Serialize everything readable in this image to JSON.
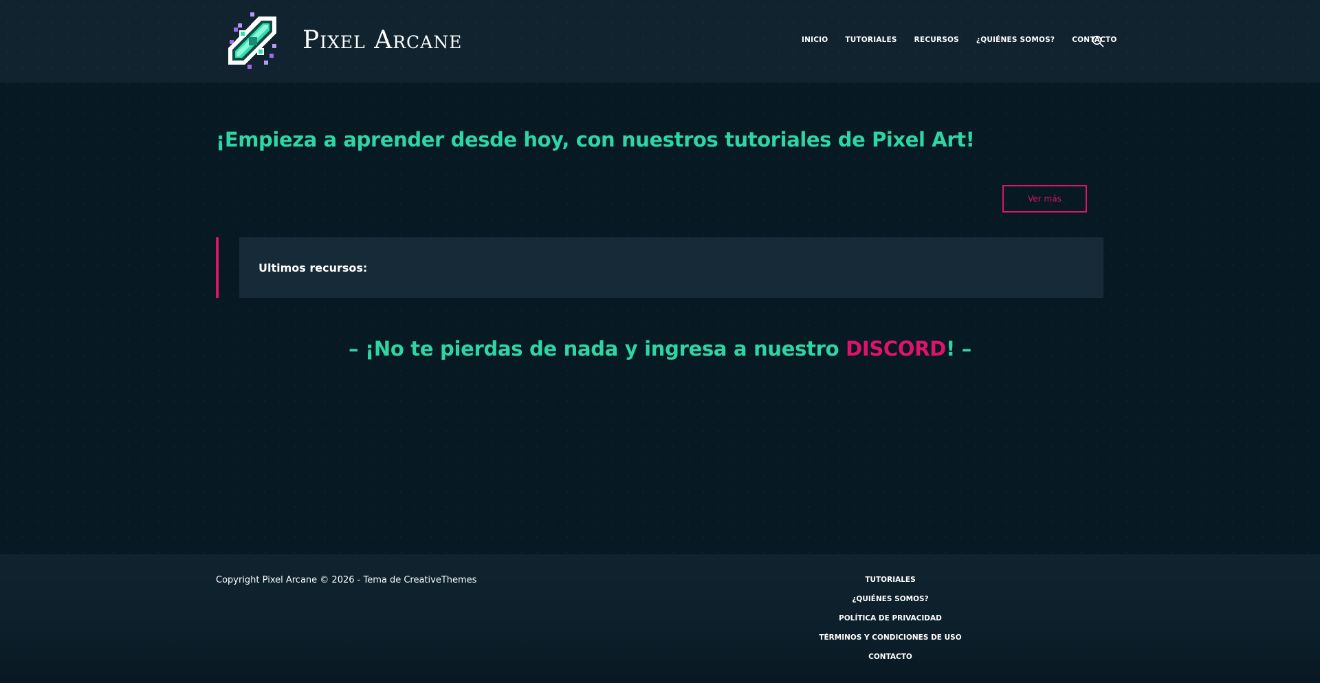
{
  "site": {
    "title": "Pixel Arcane"
  },
  "nav": {
    "items": [
      {
        "label": "INICIO"
      },
      {
        "label": "TUTORIALES"
      },
      {
        "label": "RECURSOS"
      },
      {
        "label": "¿QUIÉNES SOMOS?"
      },
      {
        "label": "CONTACTO"
      }
    ],
    "search_icon": "search-icon"
  },
  "hero": {
    "title": "¡Empieza a aprender desde hoy, con nuestros tutoriales de Pixel Art!",
    "button_label": "Ver más"
  },
  "resources": {
    "label": "Ultimos recursos:"
  },
  "discord": {
    "prefix": "– ¡No te pierdas de nada y ingresa a nuestro ",
    "highlight": "DISCORD",
    "suffix": "! –"
  },
  "footer": {
    "copyright": "Copyright Pixel Arcane © 2026 - Tema de CreativeThemes",
    "links": [
      {
        "label": "TUTORIALES"
      },
      {
        "label": "¿QUIÉNES SOMOS?"
      },
      {
        "label": "POLÍTICA DE PRIVACIDAD"
      },
      {
        "label": "TÉRMINOS Y CONDICIONES DE USO"
      },
      {
        "label": "CONTACTO"
      }
    ]
  },
  "colors": {
    "background": "#071923",
    "header": "#10232f",
    "accent_green": "#2ed6a4",
    "accent_pink": "#e0136b",
    "panel": "#172a37"
  }
}
